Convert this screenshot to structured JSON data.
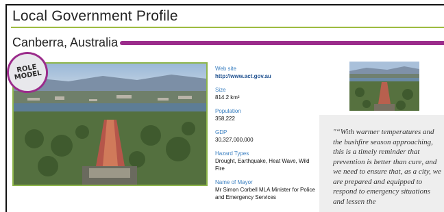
{
  "page": {
    "title": "Local Government Profile",
    "city": "Canberra, Australia"
  },
  "badge": {
    "line1": "ROLE",
    "line2": "MODEL"
  },
  "info": {
    "website_label": "Web site",
    "website_value": "http://www.act.gov.au",
    "size_label": "Size",
    "size_value": "814.2 km²",
    "population_label": "Population",
    "population_value": "358,222",
    "gdp_label": "GDP",
    "gdp_value": "30,327,000,000",
    "hazards_label": "Hazard Types",
    "hazards_value": "Drought, Earthquake, Heat Wave, Wild Fire",
    "mayor_label": "Name of Mayor",
    "mayor_value": "Mr Simon Corbell MLA Minister for Police and Emergency Services"
  },
  "quote": {
    "text": "\"“With warmer temperatures and the bushfire season approaching, this is a timely reminder that prevention is better than cure, and we need to ensure that, as a city, we are prepared and equipped to respond to emergency situations and lessen the"
  },
  "colors": {
    "title_rule": "#9dbb3f",
    "city_bar": "#9b2c8b",
    "label_blue": "#3a7fc0",
    "photo_border": "#8db54a",
    "quote_bg": "#eeeeee"
  }
}
